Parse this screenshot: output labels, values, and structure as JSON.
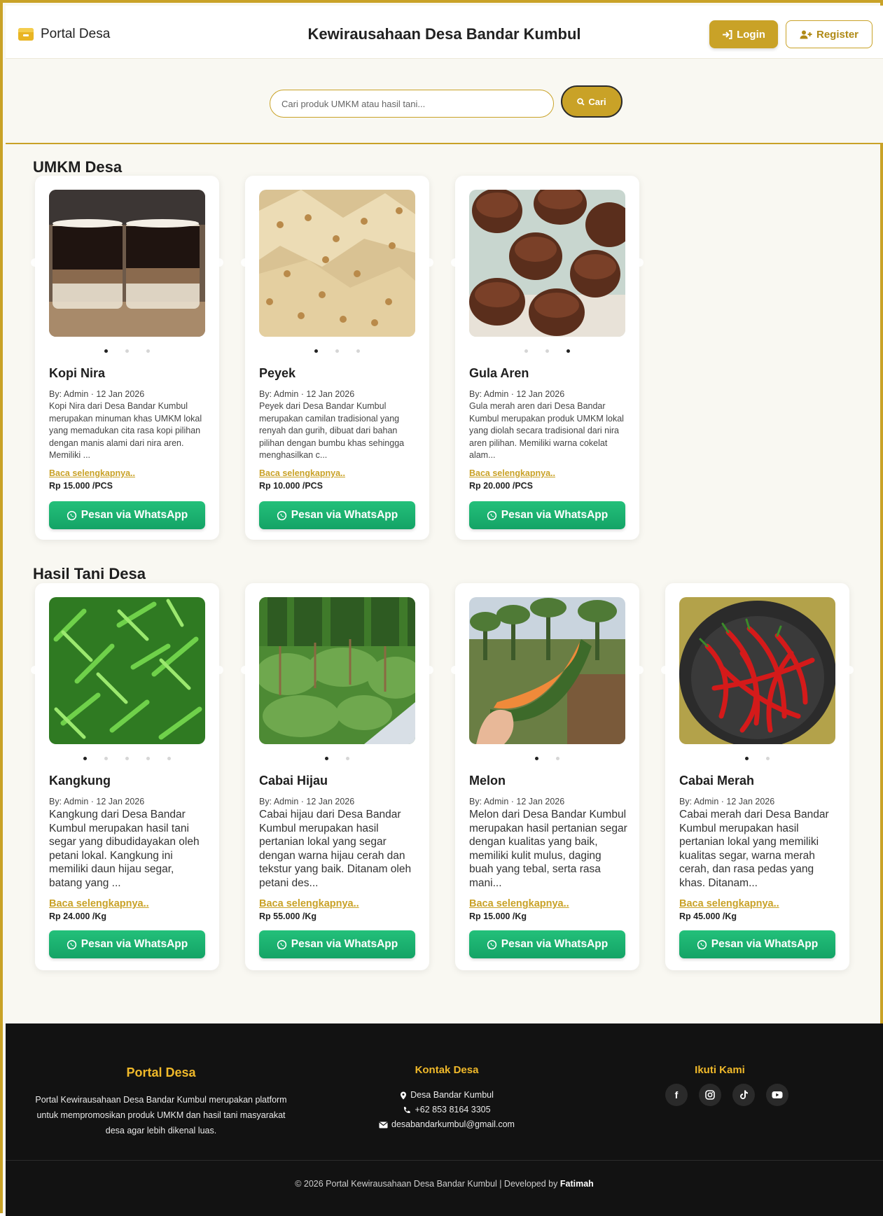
{
  "header": {
    "brand": "Portal Desa",
    "title": "Kewirausahaan Desa Bandar Kumbul",
    "login_label": "Login",
    "register_label": "Register"
  },
  "search": {
    "placeholder": "Cari produk UMKM atau hasil tani...",
    "button_label": "Cari"
  },
  "sections": [
    {
      "title": "UMKM Desa",
      "cards": [
        {
          "name": "Kopi Nira",
          "meta": "By: Admin · 12 Jan 2026",
          "description": "Kopi Nira dari Desa Bandar Kumbul merupakan minuman khas UMKM lokal yang memadukan cita rasa kopi pilihan dengan manis alami dari nira aren. Memiliki ...",
          "read_more": "Baca selengkapnya..",
          "price": "Rp 15.000 /PCS",
          "button_label": "Pesan via WhatsApp",
          "image_icon": "iced-coffee-photo",
          "slides": 3,
          "active_slide": 1
        },
        {
          "name": "Peyek",
          "meta": "By: Admin · 12 Jan 2026",
          "description": "Peyek dari Desa Bandar Kumbul merupakan camilan tradisional yang renyah dan gurih, dibuat dari bahan pilihan dengan bumbu khas sehingga menghasilkan c...",
          "read_more": "Baca selengkapnya..",
          "price": "Rp 10.000 /PCS",
          "button_label": "Pesan via WhatsApp",
          "image_icon": "peanut-cracker-photo",
          "slides": 3,
          "active_slide": 1
        },
        {
          "name": "Gula Aren",
          "meta": "By: Admin · 12 Jan 2026",
          "description": "Gula merah aren dari Desa Bandar Kumbul merupakan produk UMKM lokal yang diolah secara tradisional dari nira aren pilihan. Memiliki warna cokelat alam...",
          "read_more": "Baca selengkapnya..",
          "price": "Rp 20.000 /PCS",
          "button_label": "Pesan via WhatsApp",
          "image_icon": "palm-sugar-photo",
          "slides": 3,
          "active_slide": 3
        }
      ]
    },
    {
      "title": "Hasil Tani Desa",
      "cards": [
        {
          "name": "Kangkung",
          "meta": "By: Admin · 12 Jan 2026",
          "description": "Kangkung dari Desa Bandar Kumbul merupakan hasil tani segar yang dibudidayakan oleh petani lokal. Kangkung ini memiliki daun hijau segar, batang yang ...",
          "read_more": "Baca selengkapnya..",
          "price": "Rp 24.000 /Kg",
          "button_label": "Pesan via WhatsApp",
          "image_icon": "water-spinach-photo",
          "slides": 5,
          "active_slide": 1
        },
        {
          "name": "Cabai Hijau",
          "meta": "By: Admin · 12 Jan 2026",
          "description": "Cabai hijau dari Desa Bandar Kumbul merupakan hasil pertanian lokal yang segar dengan warna hijau cerah dan tekstur yang baik. Ditanam oleh petani des...",
          "read_more": "Baca selengkapnya..",
          "price": "Rp 55.000 /Kg",
          "button_label": "Pesan via WhatsApp",
          "image_icon": "chili-field-photo",
          "slides": 2,
          "active_slide": 1
        },
        {
          "name": "Melon",
          "meta": "By: Admin · 12 Jan 2026",
          "description": "Melon dari Desa Bandar Kumbul merupakan hasil pertanian segar dengan kualitas yang baik, memiliki kulit mulus, daging buah yang tebal, serta rasa mani...",
          "read_more": "Baca selengkapnya..",
          "price": "Rp 15.000 /Kg",
          "button_label": "Pesan via WhatsApp",
          "image_icon": "melon-slice-photo",
          "slides": 2,
          "active_slide": 1
        },
        {
          "name": "Cabai Merah",
          "meta": "By: Admin · 12 Jan 2026",
          "description": "Cabai merah dari Desa Bandar Kumbul merupakan hasil pertanian lokal yang memiliki kualitas segar, warna merah cerah, dan rasa pedas yang khas. Ditanam...",
          "read_more": "Baca selengkapnya..",
          "price": "Rp 45.000 /Kg",
          "button_label": "Pesan via WhatsApp",
          "image_icon": "red-chili-photo",
          "slides": 2,
          "active_slide": 1
        }
      ]
    }
  ],
  "footer": {
    "about_title": "Portal Desa",
    "about_text": "Portal Kewirausahaan Desa Bandar Kumbul merupakan platform untuk mempromosikan produk UMKM dan hasil tani masyarakat desa agar lebih dikenal luas.",
    "contact_title": "Kontak Desa",
    "address": "Desa Bandar Kumbul",
    "phone": "+62 853 8164 3305",
    "email": "desabandarkumbul@gmail.com",
    "follow_title": "Ikuti Kami",
    "social_icons": [
      "facebook-icon",
      "instagram-icon",
      "tiktok-icon",
      "youtube-icon"
    ],
    "copyright": "© 2026 Portal Kewirausahaan Desa Bandar Kumbul | Developed by",
    "developer": "Fatimah"
  },
  "colors": {
    "accent": "#c9a227",
    "whatsapp": "#14a366",
    "footer_bg": "#121212",
    "footer_heading": "#f0b92a"
  }
}
